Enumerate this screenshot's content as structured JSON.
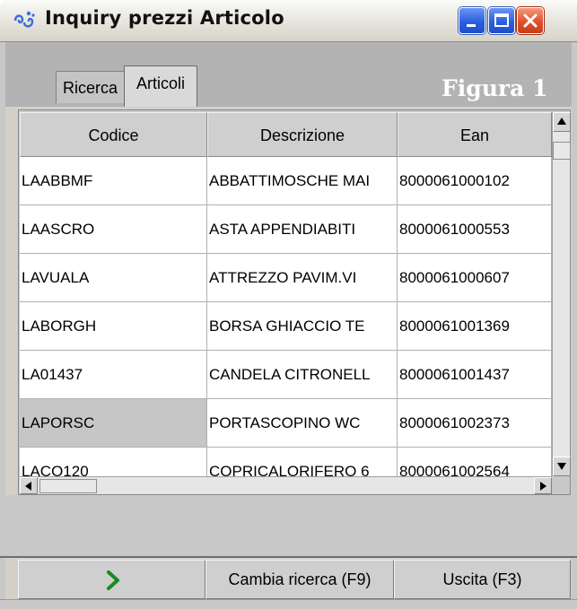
{
  "window": {
    "title": "Inquiry prezzi Articolo",
    "icon": "app-swirl-icon"
  },
  "tabs": [
    {
      "label": "Ricerca",
      "active": false
    },
    {
      "label": "Articoli",
      "active": true
    }
  ],
  "figure_label": "Figura 1",
  "table": {
    "columns": [
      "Codice",
      "Descrizione",
      "Ean"
    ],
    "rows": [
      {
        "codice": "LAABBMF",
        "descrizione": "ABBATTIMOSCHE MAI",
        "ean": "8000061000102"
      },
      {
        "codice": "LAASCRO",
        "descrizione": "ASTA APPENDIABITI",
        "ean": "8000061000553"
      },
      {
        "codice": "LAVUALA",
        "descrizione": "ATTREZZO PAVIM.VI",
        "ean": "8000061000607"
      },
      {
        "codice": "LABORGH",
        "descrizione": "BORSA GHIACCIO TE",
        "ean": "8000061001369"
      },
      {
        "codice": "LA01437",
        "descrizione": "CANDELA CITRONELL",
        "ean": "8000061001437"
      },
      {
        "codice": "LAPORSC",
        "descrizione": "PORTASCOPINO WC",
        "ean": "8000061002373"
      },
      {
        "codice": "LACO120",
        "descrizione": "COPRICALORIFERO 6",
        "ean": "8000061002564"
      }
    ],
    "selected_row": 5
  },
  "buttons": {
    "next_icon": "chevron-right-icon",
    "next_color": "#1a8a1a",
    "cambia": "Cambia ricerca (F9)",
    "uscita": "Uscita (F3)"
  },
  "colors": {
    "titlebar_button": "#2b5fe0",
    "close_button": "#e0502c",
    "selection": "#c6c6c6"
  }
}
